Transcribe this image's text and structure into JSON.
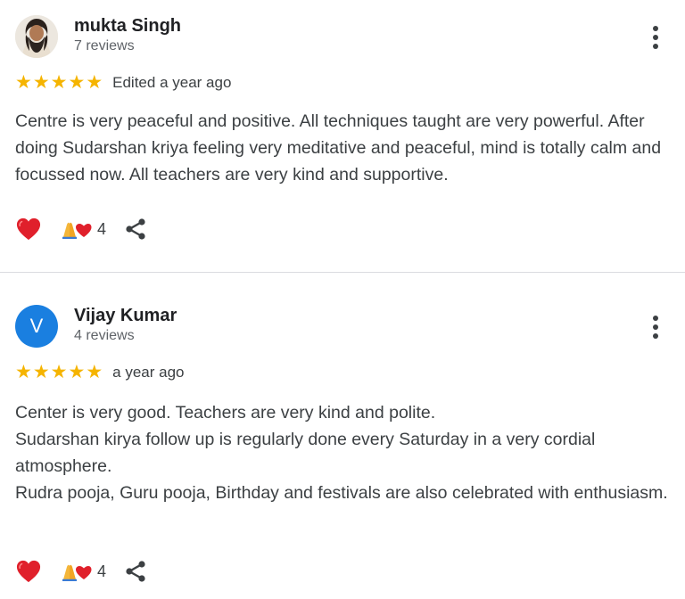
{
  "reviews": [
    {
      "name": "mukta Singh",
      "reviews_count": "7 reviews",
      "rating": 5,
      "time": "Edited a year ago",
      "text": [
        "Centre is very peaceful and positive. All techniques taught are very powerful. After doing Sudarshan kriya feeling very meditative and peaceful, mind is totally calm and focussed now. All teachers are very kind and supportive."
      ],
      "reaction_count": "4"
    },
    {
      "name": "Vijay Kumar",
      "avatar_letter": "V",
      "reviews_count": "4 reviews",
      "rating": 5,
      "time": "a year ago",
      "text": [
        "Center is very good. Teachers are very kind and polite.",
        "Sudarshan kirya follow up is regularly done every Saturday in a very cordial atmosphere.",
        "Rudra pooja, Guru pooja, Birthday and festivals are also celebrated with enthusiasm."
      ],
      "reaction_count": "4"
    }
  ],
  "colors": {
    "star": "#f5b400",
    "avatar_bg": "#1a7fe0",
    "heart": "#e0202b"
  },
  "icons": [
    "avatar-photo",
    "star-icon",
    "more-vert-icon",
    "heart-icon",
    "folded-hands-heart-icon",
    "share-icon"
  ]
}
